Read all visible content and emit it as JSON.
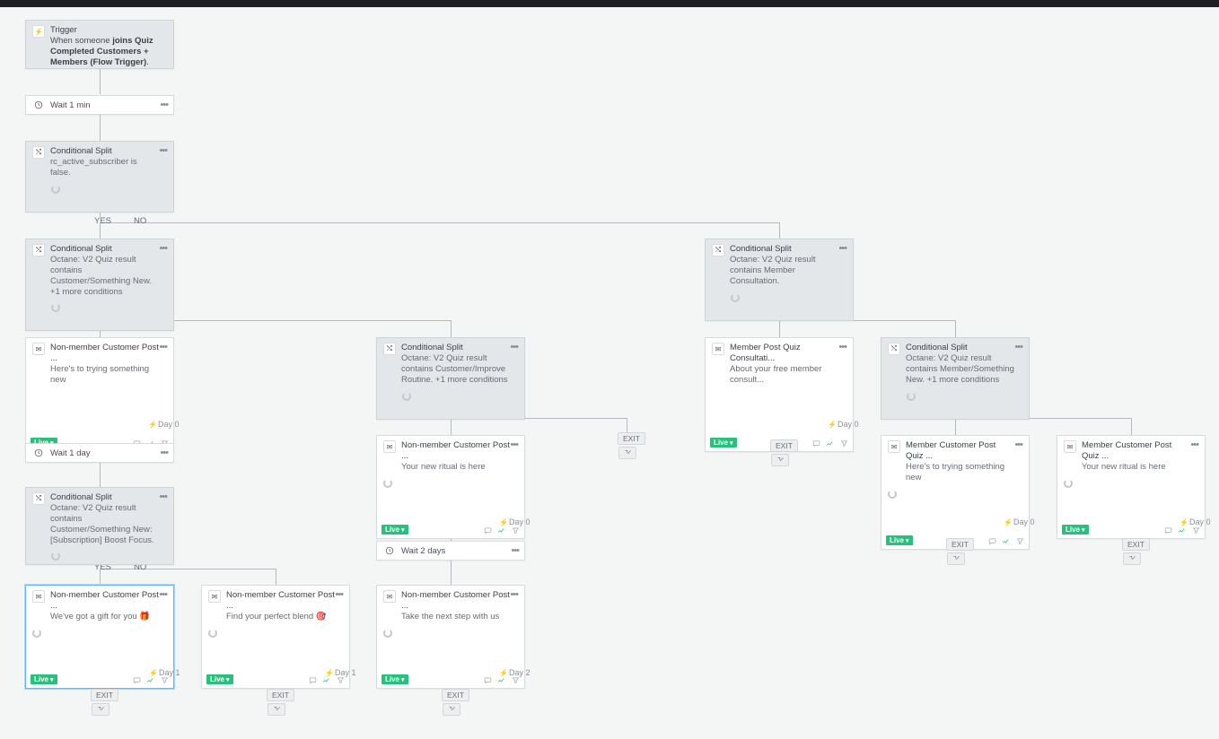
{
  "trigger": {
    "title": "Trigger",
    "prefix": "When someone ",
    "bold": "joins Quiz Completed Customers + Members (Flow Trigger)",
    "suffix": "."
  },
  "wait1": {
    "text": "Wait 1 min"
  },
  "split1": {
    "title": "Conditional Split",
    "desc": "rc_active_subscriber is false."
  },
  "split2": {
    "title": "Conditional Split",
    "desc": "Octane: V2 Quiz result contains Customer/Something New. +1 more conditions"
  },
  "split_right1": {
    "title": "Conditional Split",
    "desc": "Octane: V2 Quiz result contains Member Consultation."
  },
  "email_left1": {
    "title": "Non-member Customer Post ...",
    "subj": "Here's to trying something new"
  },
  "split_mid1": {
    "title": "Conditional Split",
    "desc": "Octane: V2 Quiz result contains Customer/Improve Routine. +1 more conditions"
  },
  "email_right1": {
    "title": "Member Post Quiz Consultati...",
    "subj": "About your free member consult..."
  },
  "split_farright": {
    "title": "Conditional Split",
    "desc": "Octane: V2 Quiz result contains Member/Something New. +1 more conditions"
  },
  "wait2": {
    "text": "Wait 1 day"
  },
  "split3": {
    "title": "Conditional Split",
    "desc": "Octane: V2 Quiz result contains Customer/Something New: [Subscription] Boost Focus."
  },
  "email_mid1": {
    "title": "Non-member Customer Post ...",
    "subj": "Your new ritual is here"
  },
  "email_r2a": {
    "title": "Member Customer Post Quiz ...",
    "subj": "Here's to trying something new"
  },
  "email_r2b": {
    "title": "Member Customer Post Quiz ...",
    "subj": "Your new ritual is here"
  },
  "wait3": {
    "text": "Wait 2 days"
  },
  "email_bl1": {
    "title": "Non-member Customer Post ...",
    "subj": "We've got a gift for you 🎁"
  },
  "email_bl2": {
    "title": "Non-member Customer Post ...",
    "subj": "Find your perfect blend 🎯"
  },
  "email_bl3": {
    "title": "Non-member Customer Post ...",
    "subj": "Take the next step with us"
  },
  "labels": {
    "yes": "YES",
    "no": "NO",
    "exit": "EXIT",
    "live": "Live",
    "day0": "Day 0",
    "day1": "Day 1",
    "day2": "Day 2"
  }
}
